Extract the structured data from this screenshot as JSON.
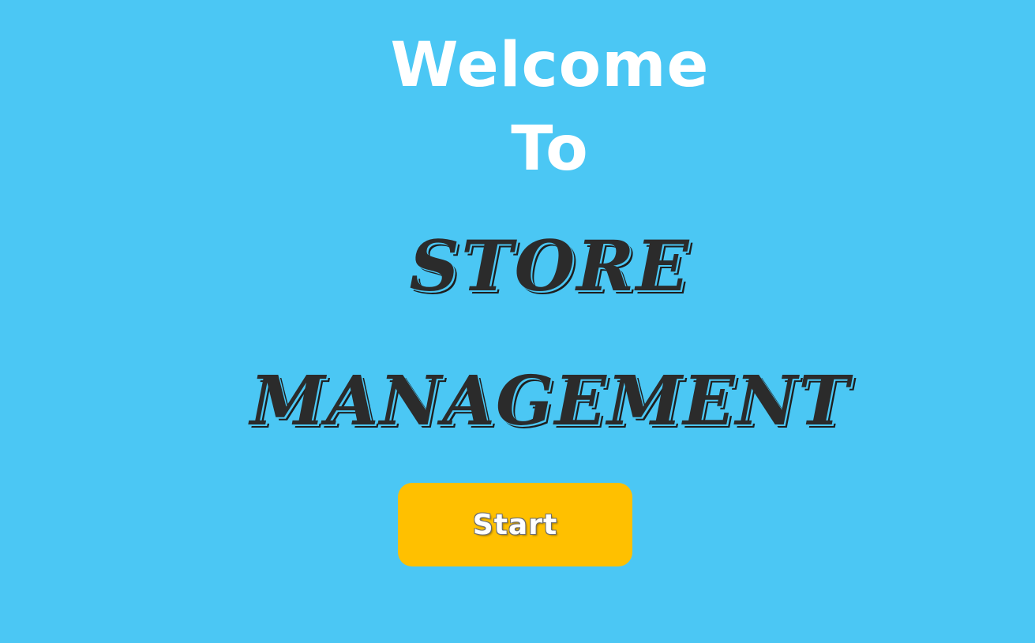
{
  "screen": {
    "background_color": "#4bc7f4"
  },
  "welcome": {
    "line1": "Welcome",
    "line2": "To"
  },
  "title": {
    "line1": "STORE",
    "line2": "MANAGEMENT"
  },
  "start_button": {
    "label": "Start",
    "color": "#ffc000"
  }
}
